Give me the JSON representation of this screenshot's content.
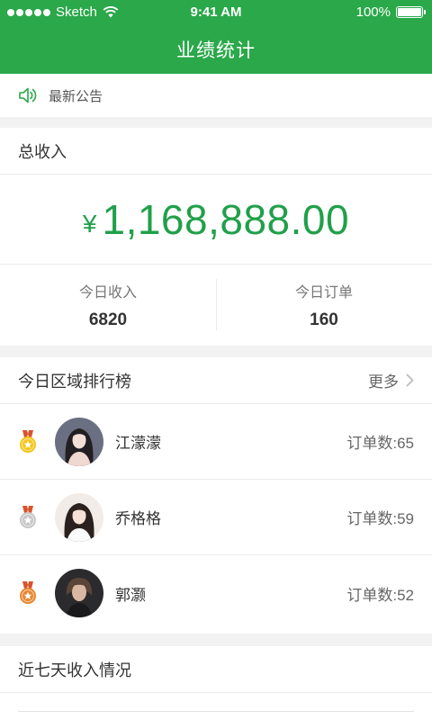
{
  "status_bar": {
    "carrier": "Sketch",
    "time": "9:41 AM",
    "battery": "100%"
  },
  "nav": {
    "title": "业绩统计"
  },
  "notice": {
    "text": "最新公告",
    "icon": "speaker-icon"
  },
  "income": {
    "title": "总收入",
    "currency": "¥",
    "total": "1,168,888.00",
    "today_income_label": "今日收入",
    "today_income_value": "6820",
    "today_orders_label": "今日订单",
    "today_orders_value": "160"
  },
  "ranking": {
    "title": "今日区域排行榜",
    "more_label": "更多",
    "items": [
      {
        "name": "江濛濛",
        "orders": "订单数:65",
        "medal": "gold"
      },
      {
        "name": "乔格格",
        "orders": "订单数:59",
        "medal": "silver"
      },
      {
        "name": "郭灏",
        "orders": "订单数:52",
        "medal": "bronze"
      }
    ]
  },
  "weekly": {
    "title": "近七天收入情况"
  },
  "colors": {
    "brand": "#2aa84a",
    "amount": "#20a04a",
    "gold": "#f5c518",
    "silver": "#c8c8c8",
    "bronze": "#e9862e",
    "ribbon": "#d9532c"
  }
}
